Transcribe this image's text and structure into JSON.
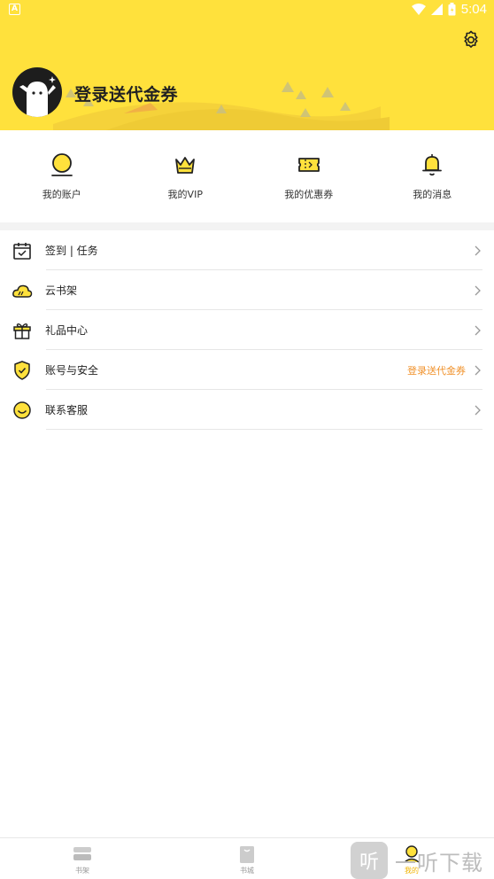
{
  "status_bar": {
    "time": "5:04",
    "left_icon": "A"
  },
  "header": {
    "login_title": "登录送代金券",
    "background": "#FFE13C"
  },
  "quick_actions": [
    {
      "label": "我的账户",
      "icon": "coin-icon"
    },
    {
      "label": "我的VIP",
      "icon": "crown-icon"
    },
    {
      "label": "我的优惠券",
      "icon": "ticket-icon"
    },
    {
      "label": "我的消息",
      "icon": "bell-icon"
    }
  ],
  "menu": [
    {
      "label": "签到 | 任务",
      "icon": "calendar-check-icon",
      "hint": ""
    },
    {
      "label": "云书架",
      "icon": "cloud-icon",
      "hint": ""
    },
    {
      "label": "礼品中心",
      "icon": "gift-icon",
      "hint": ""
    },
    {
      "label": "账号与安全",
      "icon": "shield-icon",
      "hint": "登录送代金券"
    },
    {
      "label": "联系客服",
      "icon": "smile-icon",
      "hint": ""
    }
  ],
  "bottom_nav": [
    {
      "label": "书架",
      "active": false
    },
    {
      "label": "书城",
      "active": false
    },
    {
      "label": "我的",
      "active": true
    }
  ],
  "watermark": {
    "box": "听",
    "text": "一听下载"
  },
  "colors": {
    "accent": "#FFE13C",
    "hint": "#F0912A",
    "active": "#F0B400"
  }
}
